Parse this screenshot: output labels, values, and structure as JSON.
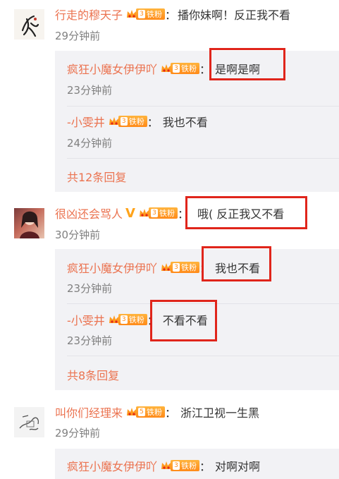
{
  "comments": [
    {
      "username": "行走的穆天子",
      "badge": {
        "level": "3",
        "text": "铁粉"
      },
      "separator": "：",
      "text": "播你妹啊！反正我不看",
      "time": "29分钟前",
      "replies": [
        {
          "username": "疯狂小魔女伊伊吖",
          "badge": {
            "level": "3",
            "text": "铁粉"
          },
          "separator": "：",
          "text": "是啊是啊",
          "time": "23分钟前"
        },
        {
          "username": "-小雯井",
          "badge": {
            "level": "3",
            "text": "铁粉"
          },
          "separator": "：",
          "text": "我也不看",
          "time": "24分钟前"
        }
      ],
      "more": "共12条回复"
    },
    {
      "username": "很凶还会骂人",
      "badge": {
        "level": "3",
        "text": "铁粉"
      },
      "verified": "V",
      "separator": "：",
      "text": "哦( 反正我又不看",
      "time": "30分钟前",
      "replies": [
        {
          "username": "疯狂小魔女伊伊吖",
          "badge": {
            "level": "3",
            "text": "铁粉"
          },
          "separator": "：",
          "text": "我也不看",
          "time": "23分钟前"
        },
        {
          "username": "-小雯井",
          "badge": {
            "level": "3",
            "text": "铁粉"
          },
          "separator": "：",
          "text": "不看不看",
          "time": "23分钟前"
        }
      ],
      "more": "共8条回复"
    },
    {
      "username": "叫你们经理来",
      "badge": {
        "level": "5",
        "text": "铁粉"
      },
      "separator": "：",
      "text": "浙江卫视一生黑",
      "time": "29分钟前",
      "replies": [
        {
          "username": "疯狂小魔女伊伊吖",
          "badge": {
            "level": "3",
            "text": "铁粉"
          },
          "separator": "：",
          "text": "对啊对啊"
        }
      ]
    }
  ],
  "colors": {
    "username": "#eb7350",
    "highlight": "#e0251b",
    "reply_bg": "#f2f2f5",
    "badge": "#ff8a19"
  }
}
